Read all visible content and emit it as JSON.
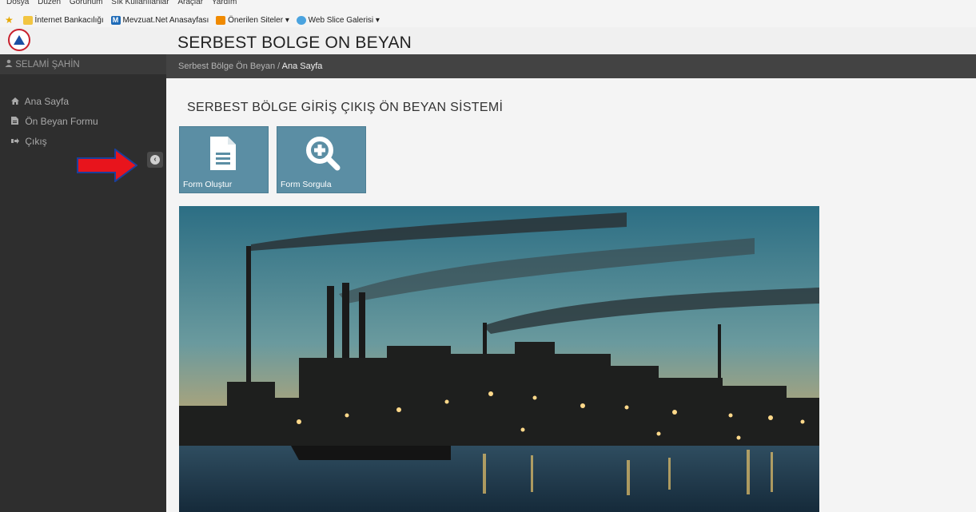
{
  "browser": {
    "menu": [
      "Dosya",
      "Düzen",
      "Görünüm",
      "Sık Kullanılanlar",
      "Araçlar",
      "Yardım"
    ],
    "favorites": [
      {
        "label": "İnternet Bankacılığı",
        "icon": "folder-icon"
      },
      {
        "label": "Mevzuat.Net Anasayfası",
        "icon": "m-logo-icon"
      },
      {
        "label": "Önerilen Siteler ▾",
        "icon": "suggested-sites-icon"
      },
      {
        "label": "Web Slice Galerisi ▾",
        "icon": "ie-icon"
      }
    ]
  },
  "app": {
    "title": "SERBEST BOLGE ON BEYAN"
  },
  "user": {
    "name": "SELAMİ ŞAHİN"
  },
  "nav": {
    "items": [
      {
        "label": "Ana Sayfa",
        "icon": "home-icon"
      },
      {
        "label": "Ön Beyan Formu",
        "icon": "file-icon"
      },
      {
        "label": "Çıkış",
        "icon": "sign-out-icon"
      }
    ]
  },
  "breadcrumb": {
    "root": "Serbest Bölge Ön Beyan",
    "separator": "/",
    "current": "Ana Sayfa"
  },
  "main": {
    "heading": "SERBEST BÖLGE GİRİŞ ÇIKIŞ ÖN BEYAN SİSTEMİ",
    "tiles": [
      {
        "label": "Form Oluştur",
        "icon": "document-icon"
      },
      {
        "label": "Form Sorgula",
        "icon": "zoom-in-icon"
      }
    ]
  },
  "colors": {
    "sidebar": "#2e2e2e",
    "breadcrumb_bar": "#434343",
    "tile": "#5b8ea4",
    "annotation_arrow": "#e8141c"
  }
}
